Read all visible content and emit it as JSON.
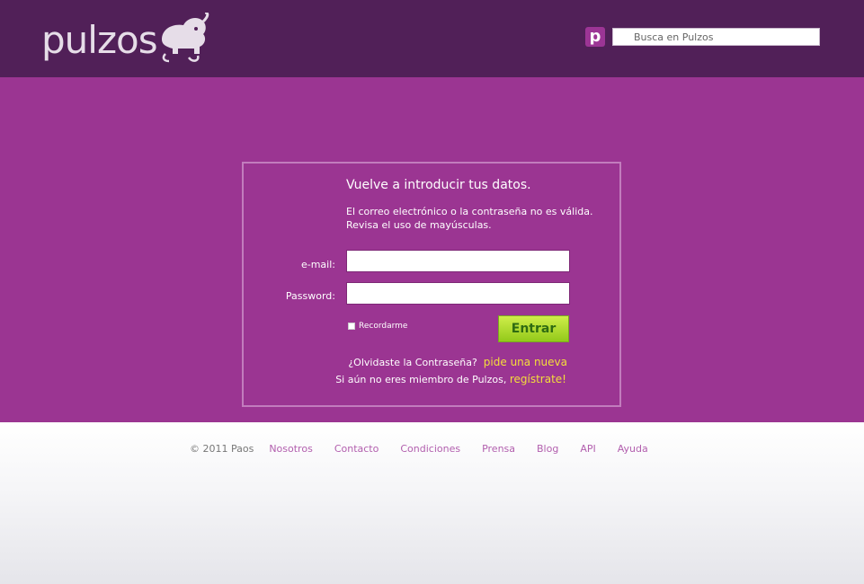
{
  "header": {
    "logo_text": "pulzos",
    "search_icon_letter": "p",
    "search_placeholder": "Busca en Pulzos"
  },
  "login": {
    "title": "Vuelve a introducir tus datos.",
    "message_line1": "El correo electrónico o la contraseña no es válida.",
    "message_line2": "Revisa el uso de mayúsculas.",
    "email_label": "e-mail:",
    "password_label": "Password:",
    "remember_label": "Recordarme",
    "submit_label": "Entrar",
    "forgot_text": "¿Olvidaste la Contraseña?",
    "forgot_link": "pide una nueva",
    "signup_text": "Si aún no eres miembro de Pulzos,",
    "signup_link": "regístrate!"
  },
  "footer": {
    "copyright": "© 2011 Paos",
    "links": [
      "Nosotros",
      "Contacto",
      "Condiciones",
      "Prensa",
      "Blog",
      "API",
      "Ayuda"
    ]
  },
  "colors": {
    "header_bg": "#512058",
    "main_bg": "#9b3592",
    "link_yellow": "#f4de3a",
    "button_green": "#aad52a",
    "footer_link": "#b25fae"
  }
}
